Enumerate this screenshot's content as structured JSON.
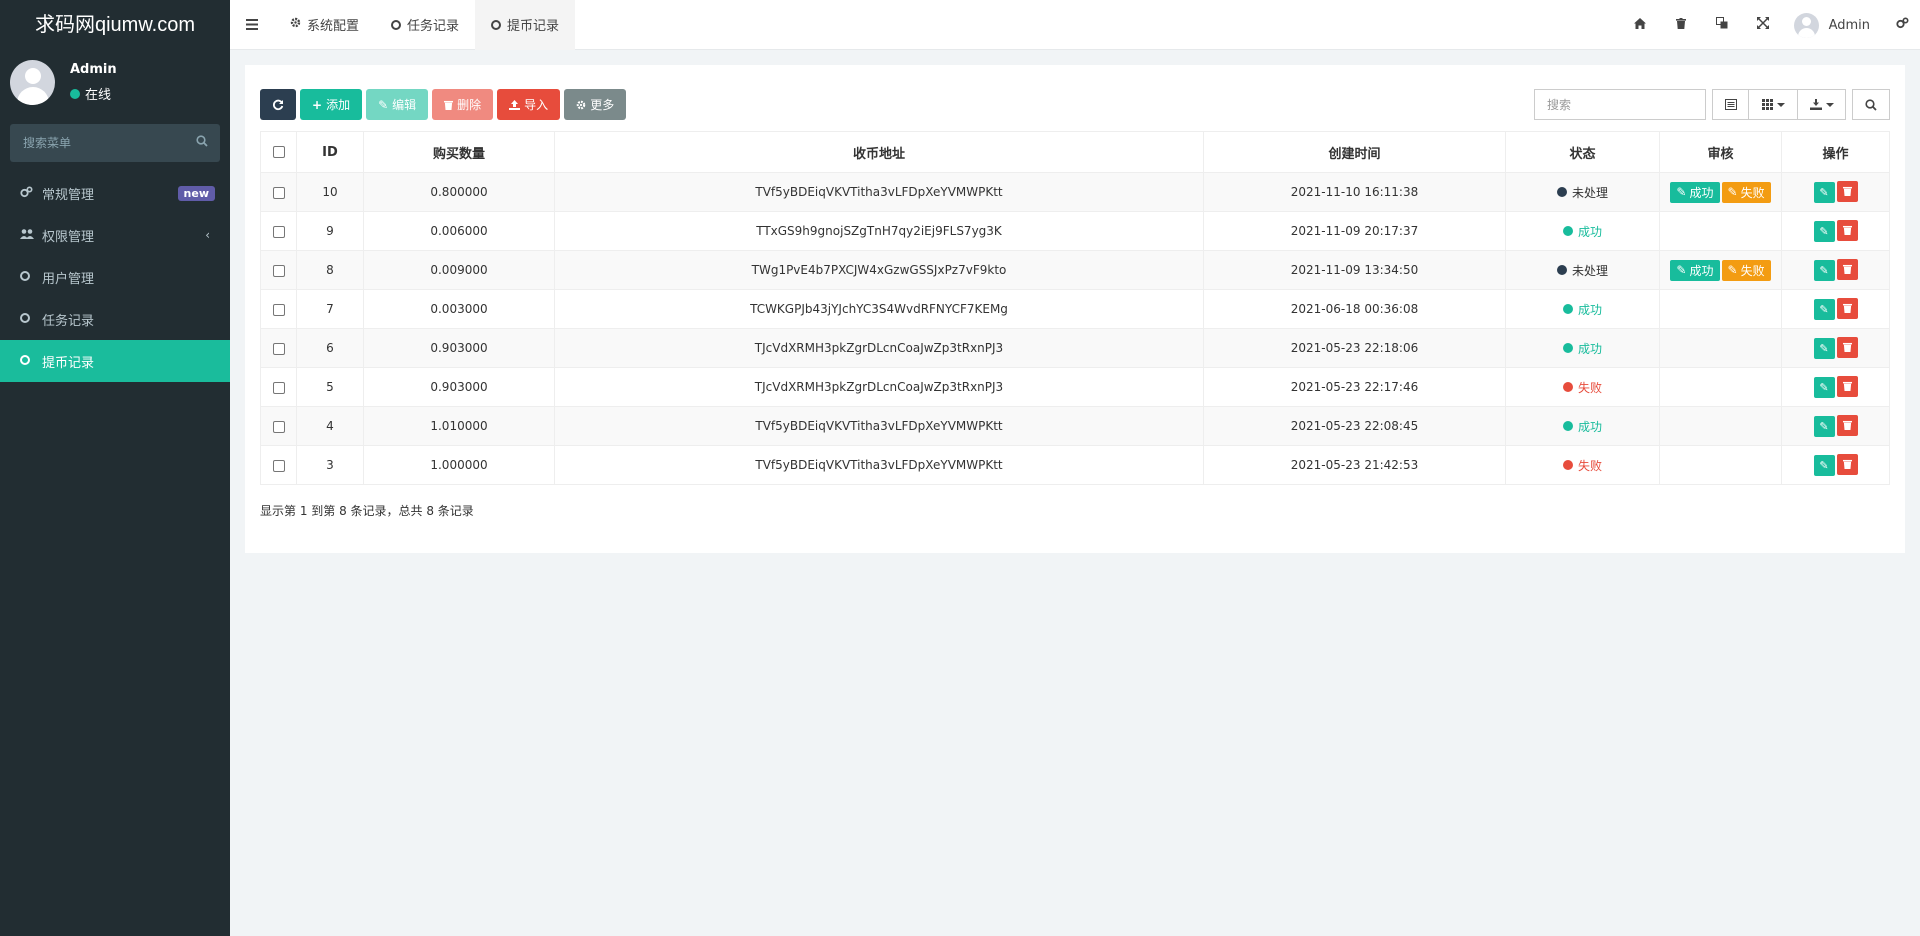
{
  "logo": "求码网qiumw.com",
  "user": {
    "name": "Admin",
    "status": "在线",
    "status_color": "#18bc9c"
  },
  "sidebar": {
    "search_placeholder": "搜索菜单",
    "items": [
      {
        "label": "常规管理",
        "icon": "cogs-icon",
        "badge": "new"
      },
      {
        "label": "权限管理",
        "icon": "users-icon",
        "chevron": "‹"
      },
      {
        "label": "用户管理",
        "icon": "circle-icon"
      },
      {
        "label": "任务记录",
        "icon": "circle-icon"
      },
      {
        "label": "提币记录",
        "icon": "circle-icon",
        "active": true
      }
    ]
  },
  "topbar": {
    "tabs": [
      {
        "label": "系统配置",
        "icon": "gear-icon"
      },
      {
        "label": "任务记录",
        "icon": "circle-icon"
      },
      {
        "label": "提币记录",
        "icon": "circle-icon",
        "active": true
      }
    ],
    "user": "Admin"
  },
  "toolbar": {
    "add": "添加",
    "edit": "编辑",
    "delete": "删除",
    "import": "导入",
    "more": "更多",
    "search_placeholder": "搜索"
  },
  "table": {
    "headers": [
      "ID",
      "购买数量",
      "收币地址",
      "创建时间",
      "状态",
      "审核",
      "操作"
    ],
    "audit_ok": "成功",
    "audit_fail": "失败",
    "rows": [
      {
        "id": "10",
        "amount": "0.800000",
        "address": "TVf5yBDEiqVKVTitha3vLFDpXeYVMWPKtt",
        "time": "2021-11-10 16:11:38",
        "status": "未处理",
        "status_type": "pending",
        "audit": true
      },
      {
        "id": "9",
        "amount": "0.006000",
        "address": "TTxGS9h9gnojSZgTnH7qy2iEj9FLS7yg3K",
        "time": "2021-11-09 20:17:37",
        "status": "成功",
        "status_type": "ok",
        "audit": false
      },
      {
        "id": "8",
        "amount": "0.009000",
        "address": "TWg1PvE4b7PXCJW4xGzwGSSJxPz7vF9kto",
        "time": "2021-11-09 13:34:50",
        "status": "未处理",
        "status_type": "pending",
        "audit": true
      },
      {
        "id": "7",
        "amount": "0.003000",
        "address": "TCWKGPJb43jYJchYC3S4WvdRFNYCF7KEMg",
        "time": "2021-06-18 00:36:08",
        "status": "成功",
        "status_type": "ok",
        "audit": false
      },
      {
        "id": "6",
        "amount": "0.903000",
        "address": "TJcVdXRMH3pkZgrDLcnCoaJwZp3tRxnPJ3",
        "time": "2021-05-23 22:18:06",
        "status": "成功",
        "status_type": "ok",
        "audit": false
      },
      {
        "id": "5",
        "amount": "0.903000",
        "address": "TJcVdXRMH3pkZgrDLcnCoaJwZp3tRxnPJ3",
        "time": "2021-05-23 22:17:46",
        "status": "失败",
        "status_type": "fail",
        "audit": false
      },
      {
        "id": "4",
        "amount": "1.010000",
        "address": "TVf5yBDEiqVKVTitha3vLFDpXeYVMWPKtt",
        "time": "2021-05-23 22:08:45",
        "status": "成功",
        "status_type": "ok",
        "audit": false
      },
      {
        "id": "3",
        "amount": "1.000000",
        "address": "TVf5yBDEiqVKVTitha3vLFDpXeYVMWPKtt",
        "time": "2021-05-23 21:42:53",
        "status": "失败",
        "status_type": "fail",
        "audit": false
      }
    ]
  },
  "footer": "显示第 1 到第 8 条记录，总共 8 条记录",
  "colors": {
    "sidebar": "#222d32",
    "accent": "#1abc9c",
    "danger": "#e74c3c",
    "warning": "#f39c12",
    "dark": "#2c3e50"
  }
}
